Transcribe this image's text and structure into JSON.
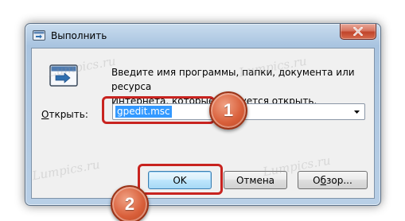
{
  "window": {
    "title": "Выполнить",
    "close_icon": "close-icon"
  },
  "dialog": {
    "icon": "run-dialog-icon",
    "description_line1": "Введите имя программы, папки, документа или ресурса",
    "description_line2": "Интернета, которые требуется открыть.",
    "open_label_accel": "О",
    "open_label_rest": "ткрыть:",
    "open_value": "gpedit.msc"
  },
  "buttons": {
    "ok": "OK",
    "cancel": "Отмена",
    "browse_prefix": "О",
    "browse_accel": "б",
    "browse_suffix": "зор..."
  },
  "annotations": {
    "step1": "1",
    "step2": "2",
    "highlight_color": "#c8231f",
    "badge_color": "#d9603b"
  },
  "watermark": {
    "text": "Lumpics.ru"
  }
}
